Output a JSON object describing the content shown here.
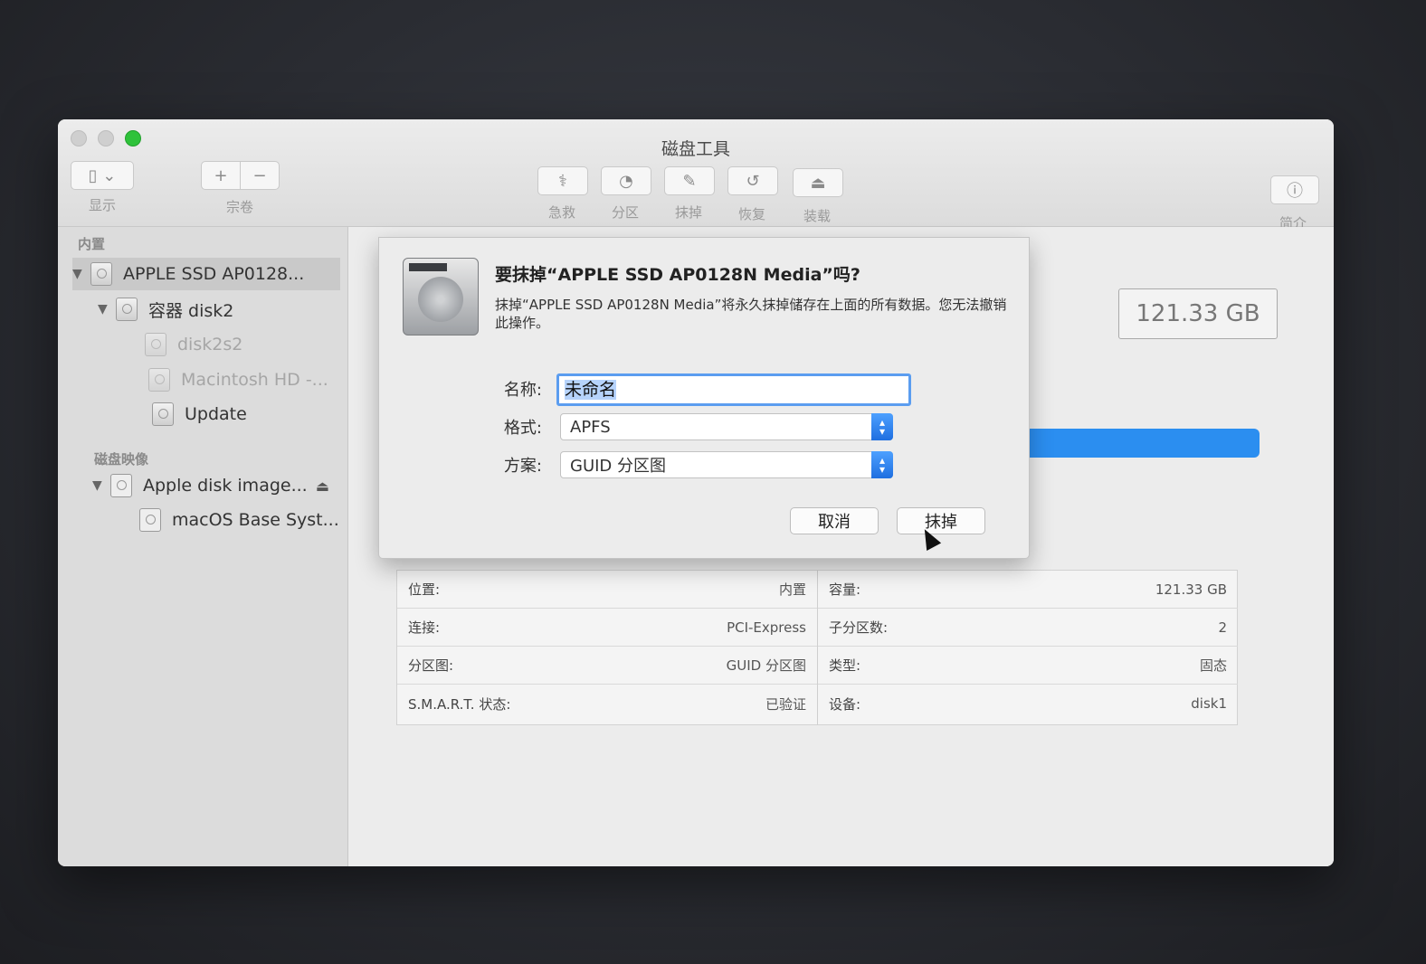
{
  "window": {
    "title": "磁盘工具"
  },
  "toolbar": {
    "view_label": "显示",
    "volume_label": "宗卷",
    "volume_add": "+",
    "volume_remove": "−",
    "first_aid_label": "急救",
    "partition_label": "分区",
    "erase_label": "抹掉",
    "restore_label": "恢复",
    "mount_label": "装载",
    "info_label": "简介"
  },
  "sidebar": {
    "section_internal": "内置",
    "section_images": "磁盘映像",
    "items": [
      {
        "label": "APPLE SSD AP0128...",
        "level": 0,
        "selected": true,
        "expanded": true
      },
      {
        "label": "容器 disk2",
        "level": 1,
        "expanded": true
      },
      {
        "label": "disk2s2",
        "level": 2,
        "dim": true
      },
      {
        "label": "Macintosh HD -...",
        "level": 2,
        "dim": true
      },
      {
        "label": "Update",
        "level": 2
      }
    ],
    "image_items": [
      {
        "label": "Apple disk image...",
        "level": 0,
        "expanded": true
      },
      {
        "label": "macOS Base Syst...",
        "level": 1
      }
    ]
  },
  "main": {
    "capacity_display": "121.33 GB",
    "bar_color": "#2b8ef0"
  },
  "info_table": {
    "left": [
      {
        "key": "位置:",
        "value": "内置"
      },
      {
        "key": "连接:",
        "value": "PCI-Express"
      },
      {
        "key": "分区图:",
        "value": "GUID 分区图"
      },
      {
        "key": "S.M.A.R.T. 状态:",
        "value": "已验证"
      }
    ],
    "right": [
      {
        "key": "容量:",
        "value": "121.33 GB"
      },
      {
        "key": "子分区数:",
        "value": "2"
      },
      {
        "key": "类型:",
        "value": "固态"
      },
      {
        "key": "设备:",
        "value": "disk1"
      }
    ]
  },
  "dialog": {
    "title": "要抹掉“APPLE SSD AP0128N Media”吗?",
    "message": "抹掉“APPLE SSD AP0128N Media”将永久抹掉储存在上面的所有数据。您无法撤销此操作。",
    "name_label": "名称:",
    "name_value": "未命名",
    "format_label": "格式:",
    "format_value": "APFS",
    "scheme_label": "方案:",
    "scheme_value": "GUID 分区图",
    "cancel_label": "取消",
    "erase_label": "抹掉"
  }
}
